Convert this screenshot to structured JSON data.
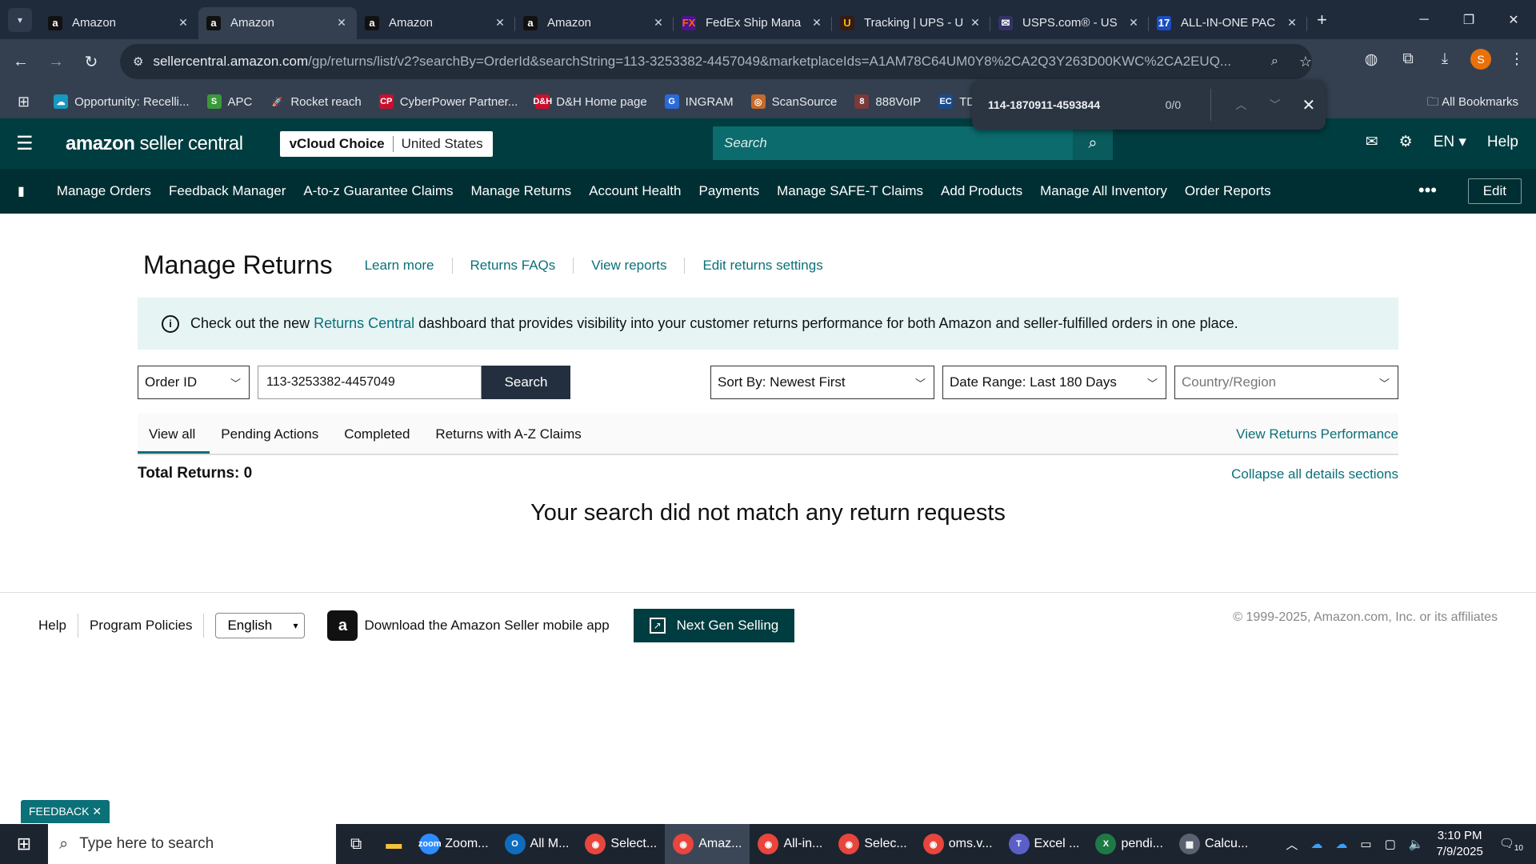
{
  "browser": {
    "tabs": [
      {
        "title": "Amazon",
        "fav": "a",
        "favbg": "#111",
        "favfg": "#fff"
      },
      {
        "title": "Amazon",
        "fav": "a",
        "favbg": "#111",
        "favfg": "#fff"
      },
      {
        "title": "Amazon",
        "fav": "a",
        "favbg": "#111",
        "favfg": "#fff"
      },
      {
        "title": "Amazon",
        "fav": "a",
        "favbg": "#111",
        "favfg": "#fff"
      },
      {
        "title": "FedEx Ship Mana",
        "fav": "FX",
        "favbg": "#4d148c",
        "favfg": "#ff6600"
      },
      {
        "title": "Tracking | UPS - U",
        "fav": "U",
        "favbg": "#351c15",
        "favfg": "#ffb500"
      },
      {
        "title": "USPS.com® - US",
        "fav": "✉",
        "favbg": "#333366",
        "favfg": "#fff"
      },
      {
        "title": "ALL-IN-ONE PAC",
        "fav": "17",
        "favbg": "#1a4dbf",
        "favfg": "#fff"
      }
    ],
    "active_tab": 1,
    "new_tab": "+",
    "url_host": "sellercentral.amazon.com",
    "url_path": "/gp/returns/list/v2?searchBy=OrderId&searchString=113-3253382-4457049&marketplaceIds=A1AM78C64UM0Y8%2CA2Q3Y263D00KWC%2CA2EUQ...",
    "profile_initial": "S",
    "bookmarks": [
      {
        "label": "Opportunity: Recelli...",
        "icon": "☁",
        "color": "#1798c1"
      },
      {
        "label": "APC",
        "icon": "S",
        "color": "#3a9a3a"
      },
      {
        "label": "Rocket reach",
        "icon": "🚀",
        "color": "#34404f"
      },
      {
        "label": "CyberPower Partner...",
        "icon": "CP",
        "color": "#c8102e"
      },
      {
        "label": "D&H Home page",
        "icon": "D&H",
        "color": "#c8102e"
      },
      {
        "label": "INGRAM",
        "icon": "G",
        "color": "#2a6ad8"
      },
      {
        "label": "ScanSource",
        "icon": "◎",
        "color": "#c46a2a"
      },
      {
        "label": "888VoIP",
        "icon": "8",
        "color": "#7a3a3a"
      },
      {
        "label": "TD",
        "icon": "EC",
        "color": "#1a4a8a"
      }
    ],
    "all_bookmarks": "All Bookmarks",
    "find": {
      "query": "114-1870911-4593844",
      "count": "0/0"
    }
  },
  "header": {
    "logo_main": "amazon",
    "logo_sub": "seller central",
    "account_name": "vCloud Choice",
    "marketplace": "United States",
    "search_placeholder": "Search",
    "language": "EN",
    "help": "Help"
  },
  "subnav": {
    "items": [
      "Manage Orders",
      "Feedback Manager",
      "A-to-z Guarantee Claims",
      "Manage Returns",
      "Account Health",
      "Payments",
      "Manage SAFE-T Claims",
      "Add Products",
      "Manage All Inventory",
      "Order Reports"
    ],
    "more": "•••",
    "edit": "Edit"
  },
  "page": {
    "title": "Manage Returns",
    "links": [
      "Learn more",
      "Returns FAQs",
      "View reports",
      "Edit returns settings"
    ],
    "banner_pre": "Check out the new ",
    "banner_link": "Returns Central",
    "banner_post": " dashboard that provides visibility into your customer returns performance for both Amazon and seller-fulfilled orders in one place.",
    "search_by": "Order ID",
    "search_value": "113-3253382-4457049",
    "search_button": "Search",
    "sort_by": "Sort By: Newest First",
    "date_range": "Date Range: Last 180 Days",
    "country_placeholder": "Country/Region",
    "tabs": [
      "View all",
      "Pending Actions",
      "Completed",
      "Returns with A-Z Claims"
    ],
    "view_performance": "View Returns Performance",
    "total_returns": "Total Returns: 0",
    "collapse_all": "Collapse all details sections",
    "no_match": "Your search did not match any return requests"
  },
  "footer": {
    "help": "Help",
    "program_policies": "Program Policies",
    "language": "English",
    "app_text": "Download the Amazon Seller mobile app",
    "next_gen": "Next Gen Selling",
    "copyright": "© 1999-2025, Amazon.com, Inc. or its affiliates"
  },
  "feedback": "FEEDBACK ✕",
  "taskbar": {
    "search_placeholder": "Type here to search",
    "apps": [
      {
        "label": "Zoom...",
        "icon": "zoom",
        "color": "#2d8cff"
      },
      {
        "label": "All M...",
        "icon": "O",
        "color": "#0f6cbd"
      },
      {
        "label": "Select...",
        "icon": "◉",
        "color": "#e8453c"
      },
      {
        "label": "Amaz...",
        "icon": "◉",
        "color": "#e8453c"
      },
      {
        "label": "All-in...",
        "icon": "◉",
        "color": "#e8453c"
      },
      {
        "label": "Selec...",
        "icon": "◉",
        "color": "#e8453c"
      },
      {
        "label": "oms.v...",
        "icon": "◉",
        "color": "#e8453c"
      },
      {
        "label": "Excel ...",
        "icon": "T",
        "color": "#5b5fc7"
      },
      {
        "label": "pendi...",
        "icon": "X",
        "color": "#1d7a45"
      },
      {
        "label": "Calcu...",
        "icon": "▦",
        "color": "#5a6270"
      }
    ],
    "active_app": 3,
    "time": "3:10 PM",
    "date": "7/9/2025",
    "notif_count": "10"
  }
}
